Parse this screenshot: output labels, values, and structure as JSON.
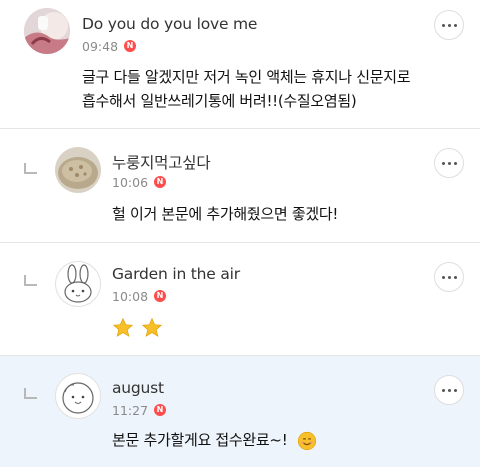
{
  "comments": [
    {
      "author": "Do you do you love me",
      "time": "09:48",
      "badge": "N",
      "lines": [
        "글구 다들 알겠지만 저거 녹인 액체는 휴지나 신문지로",
        "흡수해서 일반쓰레기통에 버려!!(수질오염됨)"
      ],
      "is_reply": false,
      "avatar_icon": "photo-avatar-icon"
    },
    {
      "author": "누룽지먹고싶다",
      "time": "10:06",
      "badge": "N",
      "lines": [
        "헐 이거 본문에 추가해줬으면 좋겠다!"
      ],
      "is_reply": true,
      "avatar_icon": "nurungji-photo-avatar-icon"
    },
    {
      "author": "Garden in the air",
      "time": "10:08",
      "badge": "N",
      "lines": [],
      "emoji": [
        "star-emoji-icon",
        "star-emoji-icon"
      ],
      "is_reply": true,
      "avatar_icon": "bunny-avatar-icon"
    },
    {
      "author": "august",
      "time": "11:27",
      "badge": "N",
      "lines": [
        "본문 추가할게요 접수완료~!"
      ],
      "emoji": [
        "smiling-face-emoji-icon"
      ],
      "is_reply": true,
      "highlighted": true,
      "avatar_icon": "cartoon-face-avatar-icon"
    }
  ],
  "colors": {
    "badge": "#ff4c4c",
    "highlight_bg": "#eef4fb",
    "divider": "#e6e6e6",
    "star": "#f7c02b"
  }
}
